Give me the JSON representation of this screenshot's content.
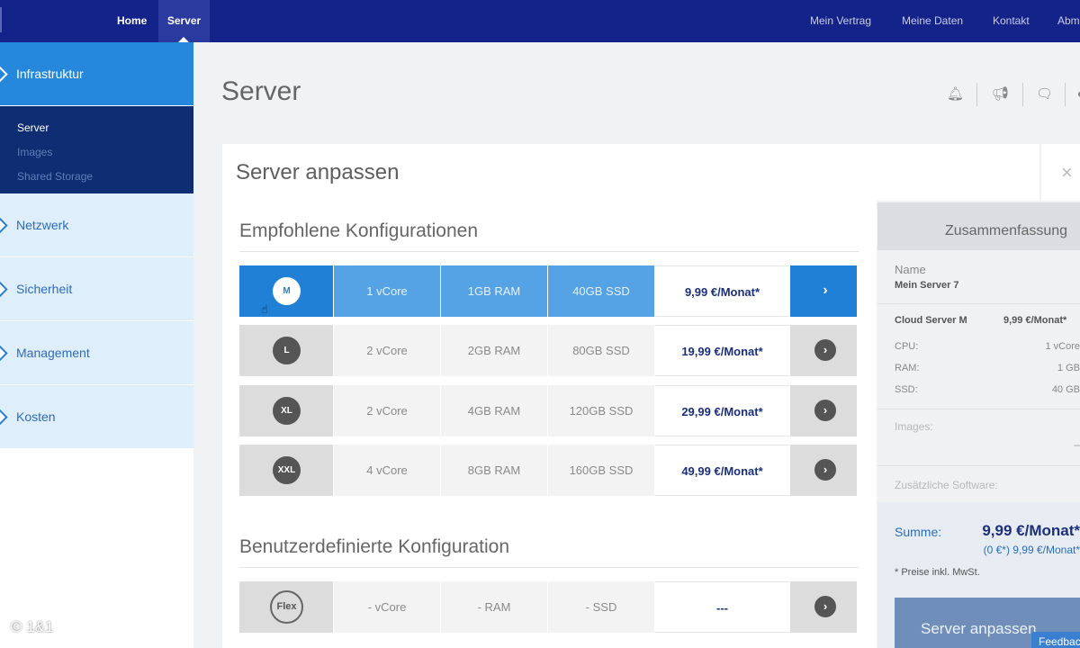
{
  "topnav": {
    "home": "Home",
    "server": "Server",
    "links": [
      "Mein Vertrag",
      "Meine Daten",
      "Kontakt",
      "Abm"
    ]
  },
  "sidebar": {
    "sections": [
      {
        "label": "Infrastruktur",
        "active": true
      },
      {
        "label": "Netzwerk"
      },
      {
        "label": "Sicherheit"
      },
      {
        "label": "Management"
      },
      {
        "label": "Kosten"
      }
    ],
    "sub_items": [
      "Server",
      "Images",
      "Shared Storage"
    ]
  },
  "watermark": "© 1&1",
  "page": {
    "title": "Server",
    "icons": [
      "bell-icon",
      "megaphone-icon",
      "chat-icon",
      "help-icon"
    ]
  },
  "panel": {
    "title": "Server anpassen",
    "close": "×",
    "recommended_title": "Empfohlene Konfigurationen",
    "custom_title": "Benutzerdefinierte Konfiguration"
  },
  "configs": [
    {
      "size": "M",
      "core": "1 vCore",
      "ram": "1GB RAM",
      "ssd": "40GB SSD",
      "price": "9,99 €/Monat*",
      "selected": true
    },
    {
      "size": "L",
      "core": "2 vCore",
      "ram": "2GB RAM",
      "ssd": "80GB SSD",
      "price": "19,99 €/Monat*"
    },
    {
      "size": "XL",
      "core": "2 vCore",
      "ram": "4GB RAM",
      "ssd": "120GB SSD",
      "price": "29,99 €/Monat*"
    },
    {
      "size": "XXL",
      "core": "4 vCore",
      "ram": "8GB RAM",
      "ssd": "160GB SSD",
      "price": "49,99 €/Monat*"
    }
  ],
  "custom": {
    "size": "Flex",
    "core": "- vCore",
    "ram": "- RAM",
    "ssd": "- SSD",
    "price": "---"
  },
  "summary": {
    "title": "Zusammenfassung",
    "name_label": "Name",
    "name_value": "Mein Server 7",
    "plan_label": "Cloud Server M",
    "plan_price": "9,99 €/Monat*",
    "cpu_label": "CPU:",
    "cpu_value": "1 vCore",
    "ram_label": "RAM:",
    "ram_value": "1 GB",
    "ssd_label": "SSD:",
    "ssd_value": "40 GB",
    "images_label": "Images:",
    "images_value": "–",
    "software_label": "Zusätzliche Software:",
    "sum_label": "Summe:",
    "sum_value": "9,99 €/Monat*",
    "sum_sub": "(0 €*) 9,99 €/Monat*",
    "vat_note": "* Preise inkl. MwSt.",
    "button": "Server anpassen"
  },
  "feedback": "Feedback"
}
